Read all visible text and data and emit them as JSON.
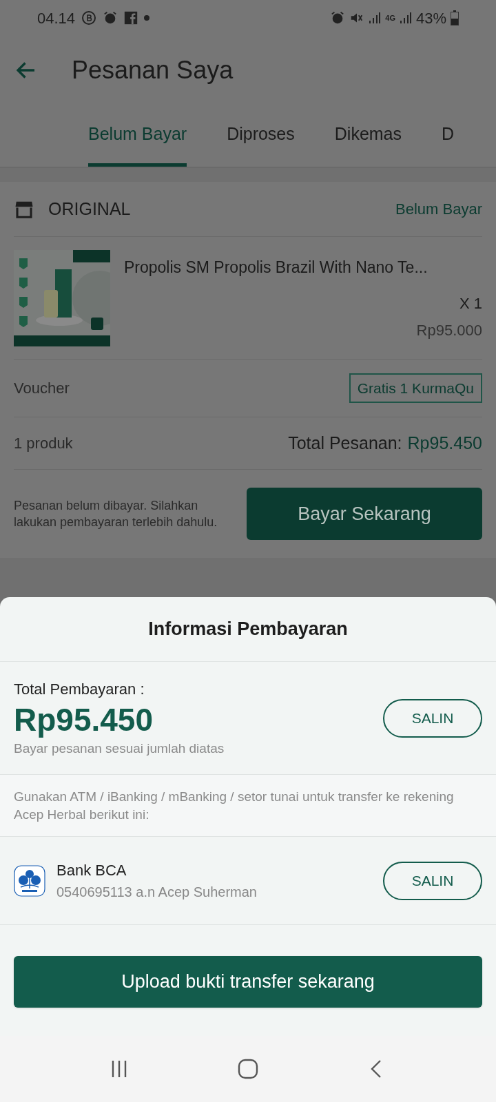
{
  "status_bar": {
    "time": "04.14",
    "network": "4G",
    "battery": "43%"
  },
  "header": {
    "title": "Pesanan Saya"
  },
  "tabs": [
    {
      "label": "Belum Bayar",
      "selected": true
    },
    {
      "label": "Diproses",
      "selected": false
    },
    {
      "label": "Dikemas",
      "selected": false
    },
    {
      "label": "D",
      "selected": false
    }
  ],
  "order": {
    "store": "ORIGINAL",
    "status": "Belum Bayar",
    "product": {
      "name": "Propolis SM Propolis Brazil With Nano Te...",
      "quantity": "X 1",
      "price": "Rp95.000"
    },
    "voucher_label": "Voucher",
    "voucher": "Gratis 1 KurmaQu",
    "count": "1 produk",
    "total_label": "Total Pesanan:",
    "total": "Rp95.450",
    "note": "Pesanan belum dibayar. Silahkan lakukan pembayaran terlebih dahulu.",
    "pay_button": "Bayar Sekarang"
  },
  "payment_sheet": {
    "title": "Informasi Pembayaran",
    "total_label": "Total Pembayaran :",
    "total": "Rp95.450",
    "copy_button": "SALIN",
    "hint": "Bayar pesanan sesuai jumlah diatas",
    "instruction": "Gunakan ATM / iBanking / mBanking / setor tunai untuk transfer ke rekening Acep Herbal berikut ini:",
    "banks": [
      {
        "name": "Bank BCA",
        "account": "0540695113 a.n Acep Suherman",
        "copy_button": "SALIN"
      }
    ],
    "upload_button": "Upload bukti transfer sekarang"
  }
}
